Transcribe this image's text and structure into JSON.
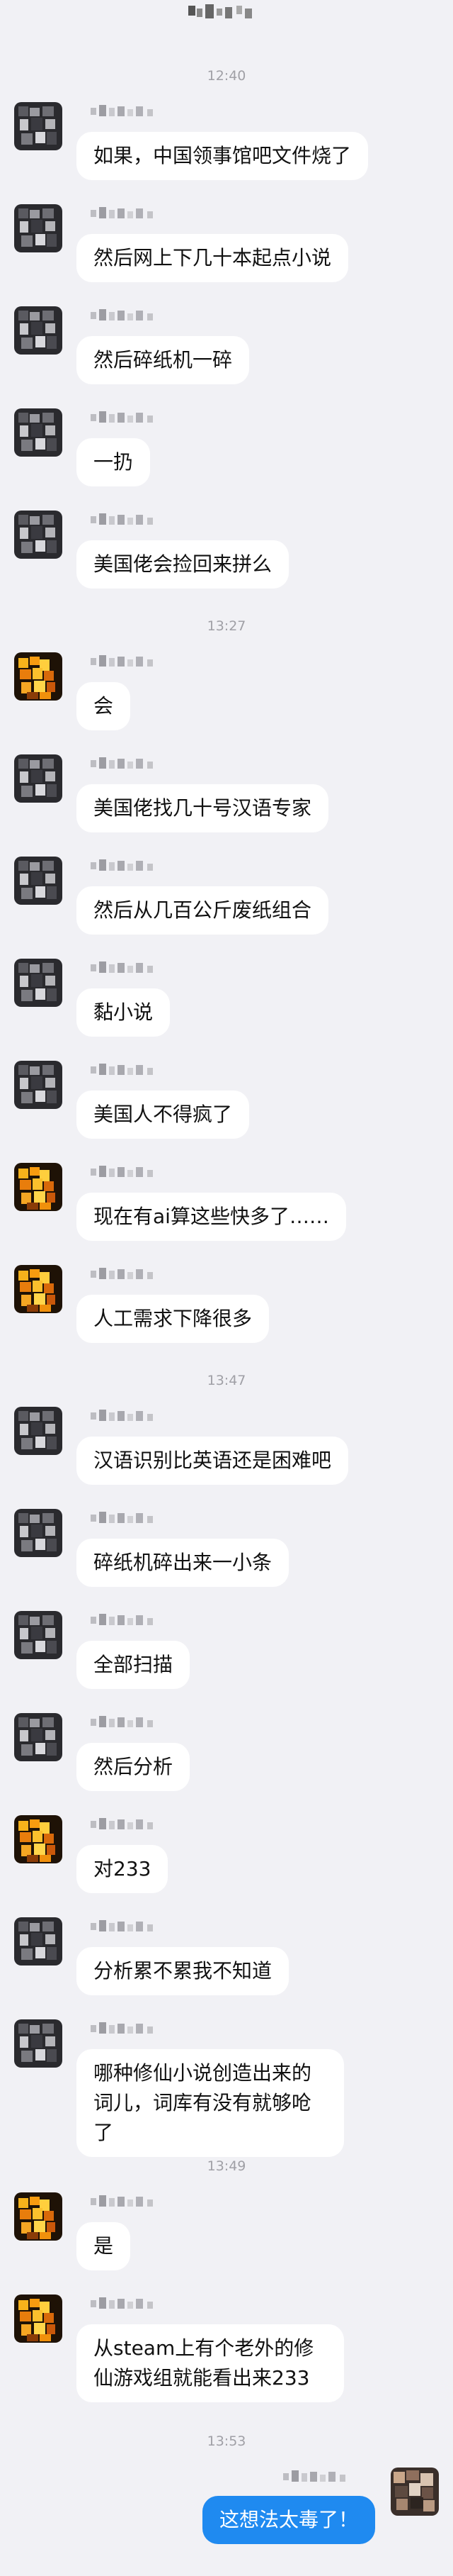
{
  "colors": {
    "background": "#f1f1f5",
    "bubble_incoming": "#ffffff",
    "bubble_outgoing": "#1f8af0",
    "timestamp": "#a0a0a6"
  },
  "chat": {
    "items": [
      {
        "type": "time",
        "text": "12:40"
      },
      {
        "type": "msg",
        "avatar": "pixel-gray",
        "text": "如果，中国领事馆吧文件烧了"
      },
      {
        "type": "msg",
        "avatar": "pixel-gray",
        "text": "然后网上下几十本起点小说"
      },
      {
        "type": "msg",
        "avatar": "pixel-gray",
        "text": "然后碎纸机一碎"
      },
      {
        "type": "msg",
        "avatar": "pixel-gray",
        "text": "一扔"
      },
      {
        "type": "msg",
        "avatar": "pixel-gray",
        "text": "美国佬会捡回来拼么"
      },
      {
        "type": "time",
        "text": "13:27"
      },
      {
        "type": "msg",
        "avatar": "pixel-orange",
        "text": "会"
      },
      {
        "type": "msg",
        "avatar": "pixel-gray",
        "text": "美国佬找几十号汉语专家"
      },
      {
        "type": "msg",
        "avatar": "pixel-gray",
        "text": "然后从几百公斤废纸组合"
      },
      {
        "type": "msg",
        "avatar": "pixel-gray",
        "text": "黏小说"
      },
      {
        "type": "msg",
        "avatar": "pixel-gray",
        "text": "美国人不得疯了"
      },
      {
        "type": "msg",
        "avatar": "pixel-orange",
        "text": "现在有ai算这些快多了……"
      },
      {
        "type": "msg",
        "avatar": "pixel-orange",
        "text": "人工需求下降很多"
      },
      {
        "type": "time",
        "text": "13:47"
      },
      {
        "type": "msg",
        "avatar": "pixel-gray",
        "text": "汉语识别比英语还是困难吧"
      },
      {
        "type": "msg",
        "avatar": "pixel-gray",
        "text": "碎纸机碎出来一小条"
      },
      {
        "type": "msg",
        "avatar": "pixel-gray",
        "text": "全部扫描"
      },
      {
        "type": "msg",
        "avatar": "pixel-gray",
        "text": "然后分析"
      },
      {
        "type": "msg",
        "avatar": "pixel-orange",
        "text": "对233"
      },
      {
        "type": "msg",
        "avatar": "pixel-gray",
        "text": "分析累不累我不知道"
      },
      {
        "type": "msg",
        "avatar": "pixel-gray",
        "text": "哪种修仙小说创造出来的词儿，词库有没有就够呛了"
      },
      {
        "type": "time",
        "text": "13:49"
      },
      {
        "type": "msg",
        "avatar": "pixel-orange",
        "text": "是"
      },
      {
        "type": "msg",
        "avatar": "pixel-orange",
        "text": "从steam上有个老外的修仙游戏组就能看出来233"
      },
      {
        "type": "time",
        "text": "13:53"
      },
      {
        "type": "self",
        "avatar": "pixel-self",
        "text": "这想法太毒了！"
      }
    ]
  }
}
